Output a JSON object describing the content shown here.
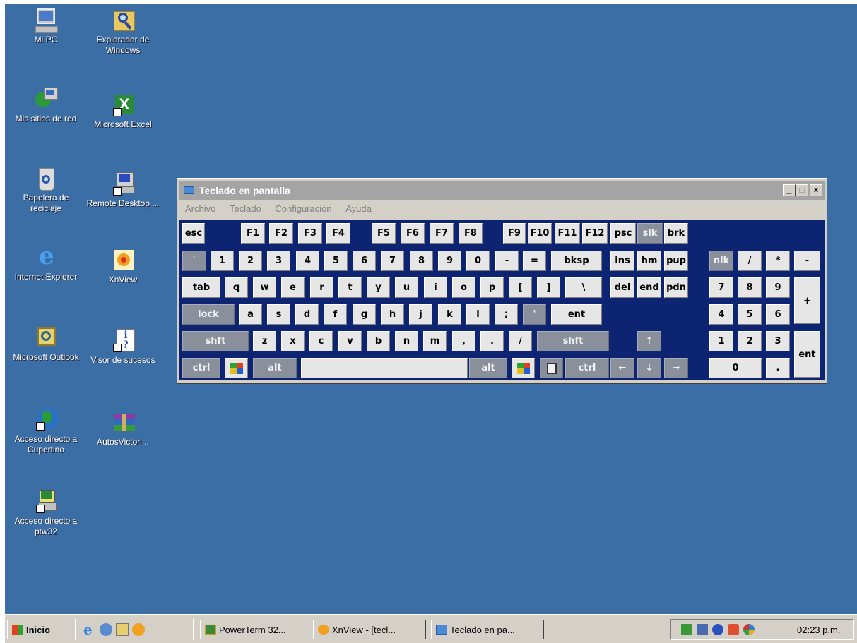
{
  "desktop": {
    "icons": [
      {
        "label": "Mi PC",
        "icon": "my-computer-icon"
      },
      {
        "label": "Explorador de Windows",
        "icon": "windows-explorer-icon"
      },
      {
        "label": "Mis sitios de red",
        "icon": "network-places-icon"
      },
      {
        "label": "Microsoft Excel",
        "icon": "excel-icon"
      },
      {
        "label": "Papelera de reciclaje",
        "icon": "recycle-bin-icon"
      },
      {
        "label": "Remote Desktop ...",
        "icon": "remote-desktop-icon"
      },
      {
        "label": "Internet Explorer",
        "icon": "internet-explorer-icon"
      },
      {
        "label": "XnView",
        "icon": "xnview-icon"
      },
      {
        "label": "Microsoft Outlook",
        "icon": "outlook-icon"
      },
      {
        "label": "Visor de sucesos",
        "icon": "event-viewer-icon"
      },
      {
        "label": "Acceso directo a Cupertino",
        "icon": "globe-shortcut-icon"
      },
      {
        "label": "AutosVictori...",
        "icon": "winrar-archive-icon"
      },
      {
        "label": "Acceso directo a ptw32",
        "icon": "terminal-shortcut-icon"
      }
    ]
  },
  "window": {
    "title": "Teclado en pantalla",
    "buttons": {
      "minimize": "_",
      "maximize": "□",
      "close": "×"
    },
    "menu": [
      "Archivo",
      "Teclado",
      "Configuración",
      "Ayuda"
    ]
  },
  "keyboard": {
    "rows": [
      [
        "esc",
        "F1",
        "F2",
        "F3",
        "F4",
        "F5",
        "F6",
        "F7",
        "F8",
        "F9",
        "F10",
        "F11",
        "F12",
        "psc",
        "slk",
        "brk"
      ],
      [
        "`",
        "1",
        "2",
        "3",
        "4",
        "5",
        "6",
        "7",
        "8",
        "9",
        "0",
        "-",
        "=",
        "bksp",
        "ins",
        "hm",
        "pup",
        "nlk",
        "/",
        "*",
        "-"
      ],
      [
        "tab",
        "q",
        "w",
        "e",
        "r",
        "t",
        "y",
        "u",
        "i",
        "o",
        "p",
        "[",
        "]",
        "\\",
        "del",
        "end",
        "pdn",
        "7",
        "8",
        "9",
        "+"
      ],
      [
        "lock",
        "a",
        "s",
        "d",
        "f",
        "g",
        "h",
        "j",
        "k",
        "l",
        ";",
        "'",
        "ent",
        "4",
        "5",
        "6"
      ],
      [
        "shft",
        "z",
        "x",
        "c",
        "v",
        "b",
        "n",
        "m",
        ",",
        ".",
        "/",
        "shft",
        "↑",
        "1",
        "2",
        "3",
        "ent"
      ],
      [
        "ctrl",
        "win",
        "alt",
        "space",
        "alt",
        "win",
        "menu",
        "ctrl",
        "←",
        "↓",
        "→",
        "0",
        "."
      ]
    ]
  },
  "taskbar": {
    "start_label": "Inicio",
    "tasks": [
      {
        "label": "PowerTerm 32...",
        "icon": "powerterm-icon"
      },
      {
        "label": "XnView - [tecl...",
        "icon": "xnview-icon"
      },
      {
        "label": "Teclado en pa...",
        "icon": "keyboard-icon"
      }
    ],
    "clock": "02:23 p.m."
  }
}
